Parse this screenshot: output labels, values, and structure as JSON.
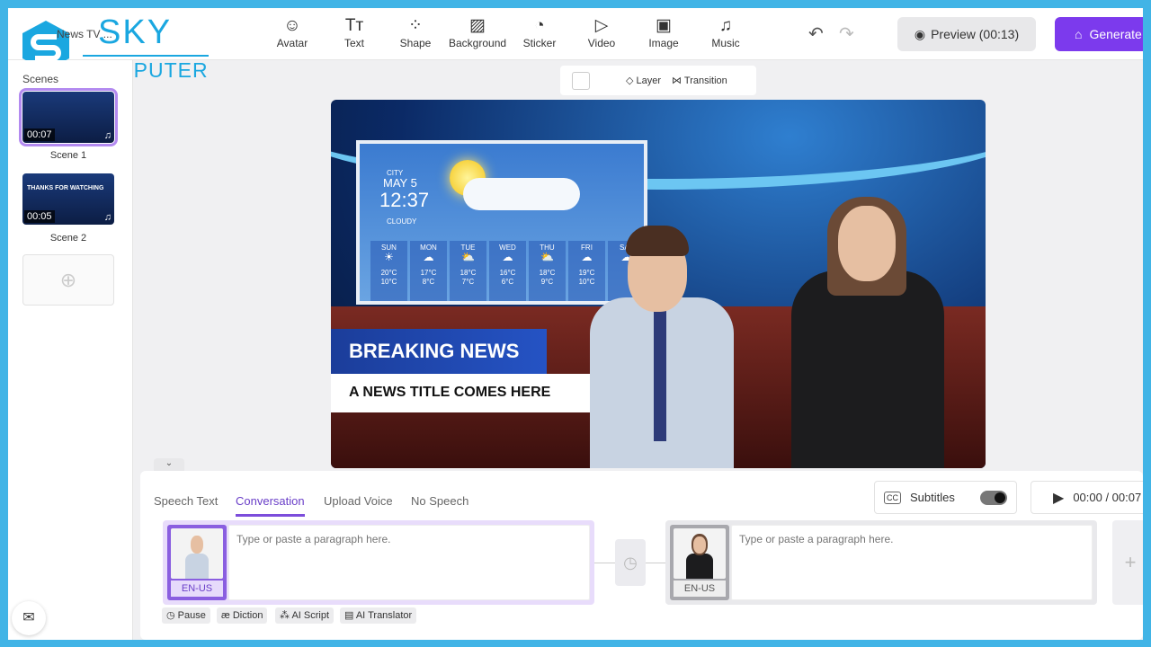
{
  "watermark": {
    "brand_line1": "SKY",
    "brand_line2": "COMPUTER"
  },
  "header": {
    "project_name": "News TV ...",
    "undo_icon": "undo-icon",
    "redo_icon": "redo-icon",
    "preview_label": "Preview (00:13)",
    "generate_label": "Generate"
  },
  "toolbar": [
    {
      "label": "Avatar",
      "icon": "avatar-icon",
      "glyph": "☺"
    },
    {
      "label": "Text",
      "icon": "text-icon",
      "glyph": "Tт"
    },
    {
      "label": "Shape",
      "icon": "shape-icon",
      "glyph": "⁘"
    },
    {
      "label": "Background",
      "icon": "background-icon",
      "glyph": "▨"
    },
    {
      "label": "Sticker",
      "icon": "sticker-icon",
      "glyph": "◔"
    },
    {
      "label": "Video",
      "icon": "video-icon",
      "glyph": "▷"
    },
    {
      "label": "Image",
      "icon": "image-icon",
      "glyph": "▣"
    },
    {
      "label": "Music",
      "icon": "music-icon",
      "glyph": "♫"
    }
  ],
  "sidebar": {
    "title": "Scenes",
    "scenes": [
      {
        "name": "Scene 1",
        "duration": "00:07",
        "selected": true
      },
      {
        "name": "Scene 2",
        "duration": "00:05",
        "overlay_text": "THANKS FOR WATCHING",
        "selected": false
      }
    ]
  },
  "canvas_toolbar": {
    "layer": "Layer",
    "transition": "Transition"
  },
  "scene": {
    "weather": {
      "city": "CITY",
      "date": "MAY 5",
      "time": "12:37",
      "condition": "CLOUDY",
      "days": [
        {
          "day": "SUN",
          "high": "20°C",
          "low": "10°C",
          "icon": "sunny"
        },
        {
          "day": "MON",
          "high": "17°C",
          "low": "8°C",
          "icon": "cloudy"
        },
        {
          "day": "TUE",
          "high": "18°C",
          "low": "7°C",
          "icon": "partly-cloudy"
        },
        {
          "day": "WED",
          "high": "16°C",
          "low": "6°C",
          "icon": "cloudy"
        },
        {
          "day": "THU",
          "high": "18°C",
          "low": "9°C",
          "icon": "partly-cloudy"
        },
        {
          "day": "FRI",
          "high": "19°C",
          "low": "10°C",
          "icon": "cloudy"
        },
        {
          "day": "SAT",
          "high": "",
          "low": "",
          "icon": "cloudy"
        }
      ]
    },
    "headline": "BREAKING NEWS",
    "title": "A NEWS TITLE COMES HERE"
  },
  "speech": {
    "tabs": [
      "Speech Text",
      "Conversation",
      "Upload Voice",
      "No Speech"
    ],
    "active_tab": "Conversation",
    "subtitles_label": "Subtitles",
    "subtitles_on": true,
    "time": "00:00 / 00:07",
    "lines": [
      {
        "lang": "EN-US",
        "placeholder": "Type or paste a paragraph here."
      },
      {
        "lang": "EN-US",
        "placeholder": "Type or paste a paragraph here."
      }
    ],
    "tools": [
      "Pause",
      "Diction",
      "AI Script",
      "AI Translator"
    ]
  },
  "colors": {
    "accent": "#7c3aed",
    "frame": "#41b4e6"
  }
}
